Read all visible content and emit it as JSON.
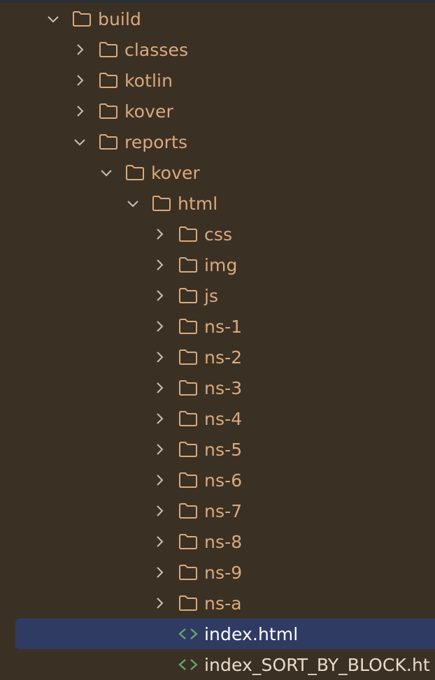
{
  "project_tree": {
    "colors": {
      "background": "#3b3024",
      "folder_text": "#d9aa7e",
      "folder_icon": "#d9aa7e",
      "chevron": "#c9c2b8",
      "selection": "#2f3b63",
      "html_icon": "#6aa86f"
    },
    "items": [
      {
        "label": "build",
        "expanded": true,
        "icon": "folder-icon"
      },
      {
        "label": "classes",
        "expanded": false,
        "icon": "folder-icon"
      },
      {
        "label": "kotlin",
        "expanded": false,
        "icon": "folder-icon"
      },
      {
        "label": "kover",
        "expanded": false,
        "icon": "folder-icon"
      },
      {
        "label": "reports",
        "expanded": true,
        "icon": "folder-icon"
      },
      {
        "label": "kover",
        "expanded": true,
        "icon": "folder-icon"
      },
      {
        "label": "html",
        "expanded": true,
        "icon": "folder-icon"
      },
      {
        "label": "css",
        "expanded": false,
        "icon": "folder-icon"
      },
      {
        "label": "img",
        "expanded": false,
        "icon": "folder-icon"
      },
      {
        "label": "js",
        "expanded": false,
        "icon": "folder-icon"
      },
      {
        "label": "ns-1",
        "expanded": false,
        "icon": "folder-icon"
      },
      {
        "label": "ns-2",
        "expanded": false,
        "icon": "folder-icon"
      },
      {
        "label": "ns-3",
        "expanded": false,
        "icon": "folder-icon"
      },
      {
        "label": "ns-4",
        "expanded": false,
        "icon": "folder-icon"
      },
      {
        "label": "ns-5",
        "expanded": false,
        "icon": "folder-icon"
      },
      {
        "label": "ns-6",
        "expanded": false,
        "icon": "folder-icon"
      },
      {
        "label": "ns-7",
        "expanded": false,
        "icon": "folder-icon"
      },
      {
        "label": "ns-8",
        "expanded": false,
        "icon": "folder-icon"
      },
      {
        "label": "ns-9",
        "expanded": false,
        "icon": "folder-icon"
      },
      {
        "label": "ns-a",
        "expanded": false,
        "icon": "folder-icon"
      },
      {
        "label": "index.html",
        "selected": true,
        "icon": "html-file-icon"
      },
      {
        "label": "index_SORT_BY_BLOCK.ht",
        "icon": "html-file-icon"
      }
    ]
  }
}
